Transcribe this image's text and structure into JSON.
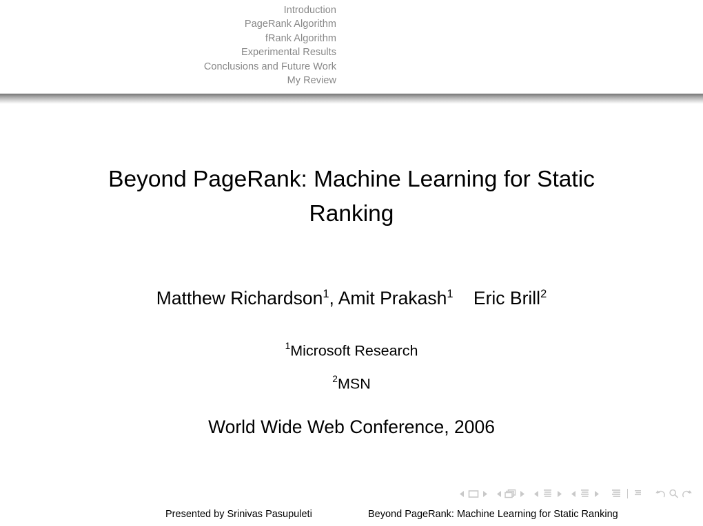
{
  "header": {
    "nav_items": [
      {
        "label": "Introduction"
      },
      {
        "label": "PageRank Algorithm"
      },
      {
        "label": "fRank Algorithm"
      },
      {
        "label": "Experimental Results"
      },
      {
        "label": "Conclusions and Future Work"
      },
      {
        "label": "My Review"
      }
    ],
    "text_color": "#888888",
    "rule_color": "#6f6f6f"
  },
  "title_slide": {
    "title": "Beyond PageRank: Machine Learning for Static Ranking",
    "authors": {
      "author1_name": "Matthew Richardson",
      "author1_sup": "1",
      "separator1": ", ",
      "author2_name": "Amit Prakash",
      "author2_sup": "1",
      "gap": "    ",
      "author3_name": "Eric Brill",
      "author3_sup": "2"
    },
    "affiliations": [
      {
        "marker": "1",
        "name": "Microsoft Research"
      },
      {
        "marker": "2",
        "name": "MSN"
      }
    ],
    "venue": "World Wide Web Conference, 2006"
  },
  "nav_symbols": {
    "groups": [
      {
        "name": "slide",
        "icon": "slide-icon",
        "prev": "◂",
        "next": "▸"
      },
      {
        "name": "frame",
        "icon": "frame-icon",
        "prev": "◂",
        "next": "▸"
      },
      {
        "name": "subsection",
        "icon": "subsection-icon",
        "prev": "◂",
        "next": "▸"
      },
      {
        "name": "section",
        "icon": "section-icon",
        "prev": "◂",
        "next": "▸"
      }
    ],
    "doc_icon": "document-icon",
    "appendix_icon": "appendix-icon",
    "back_icon": "go-back-icon",
    "search_icon": "search-icon",
    "forward_icon": "go-forward-icon",
    "color": "#c9c9c9"
  },
  "footer": {
    "left": "Presented by Srinivas Pasupuleti",
    "right": "Beyond PageRank: Machine Learning for Static Ranking"
  }
}
